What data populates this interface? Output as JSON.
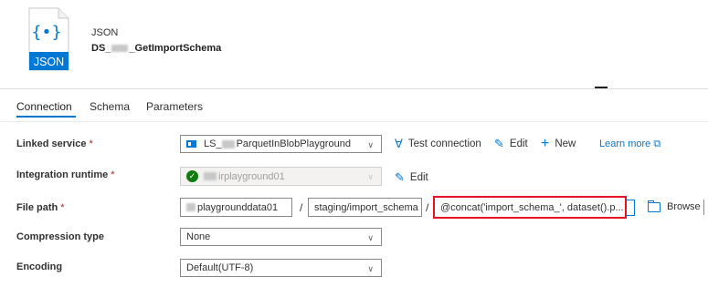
{
  "header": {
    "icon_badge": "JSON",
    "icon_glyph": "{•}",
    "type_label": "JSON",
    "name_prefix": "DS_",
    "name_suffix": "_GetImportSchema"
  },
  "tabs": [
    {
      "label": "Connection",
      "active": true
    },
    {
      "label": "Schema",
      "active": false
    },
    {
      "label": "Parameters",
      "active": false
    }
  ],
  "form": {
    "linked_service": {
      "label": "Linked service",
      "required_mark": "*",
      "value_prefix": "LS_",
      "value_suffix": "ParquetInBlobPlayground",
      "test_connection": "Test connection",
      "edit": "Edit",
      "new": "New",
      "learn_more": "Learn more"
    },
    "integration_runtime": {
      "label": "Integration runtime",
      "required_mark": "*",
      "value_suffix": "irplayground01",
      "edit": "Edit"
    },
    "file_path": {
      "label": "File path",
      "required_mark": "*",
      "container": "playgrounddata01",
      "directory": "staging/import_schema",
      "file_name": "@concat('import_schema_', dataset().p...",
      "separator": "/",
      "browse": "Browse"
    },
    "compression_type": {
      "label": "Compression type",
      "value": "None"
    },
    "encoding": {
      "label": "Encoding",
      "value": "Default(UTF-8)"
    }
  },
  "colors": {
    "accent": "#0078d4",
    "highlight": "#e81123",
    "success": "#107c10"
  }
}
